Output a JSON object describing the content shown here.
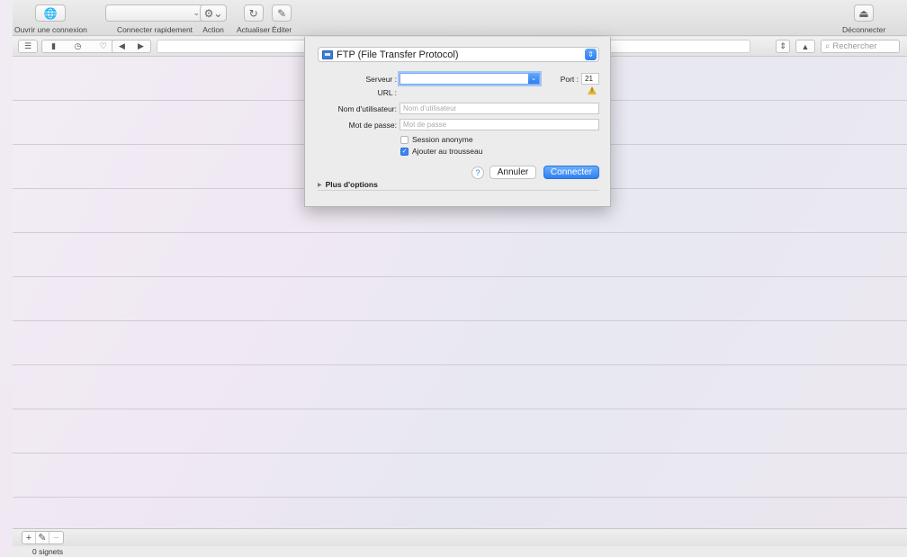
{
  "toolbar": {
    "open_connection": "Ouvrir une connexion",
    "quick_connect": "Connecter rapidement",
    "quick_connect_value": "",
    "action": "Action",
    "refresh": "Actualiser",
    "edit": "Éditer",
    "disconnect": "Déconnecter"
  },
  "pathbar": {
    "search_placeholder": "Rechercher"
  },
  "dialog": {
    "protocol": "FTP (File Transfer Protocol)",
    "server_label": "Serveur :",
    "server_value": "",
    "port_label": "Port :",
    "port_value": "21",
    "url_label": "URL :",
    "username_label": "Nom d'utilisateur:",
    "username_placeholder": "Nom d'utilisateur",
    "password_label": "Mot de passe:",
    "password_placeholder": "Mot de passe",
    "anonymous_label": "Session anonyme",
    "anonymous_checked": false,
    "keychain_label": "Ajouter au trousseau",
    "keychain_checked": true,
    "help_label": "?",
    "cancel_label": "Annuler",
    "connect_label": "Connecter",
    "more_options_label": "Plus d'options"
  },
  "bottombar": {
    "add_label": "+",
    "edit_label": "✎",
    "remove_label": "−"
  },
  "status": {
    "text": "0 signets"
  },
  "colors": {
    "accent": "#2f80f0",
    "warning": "#e3b52a"
  }
}
